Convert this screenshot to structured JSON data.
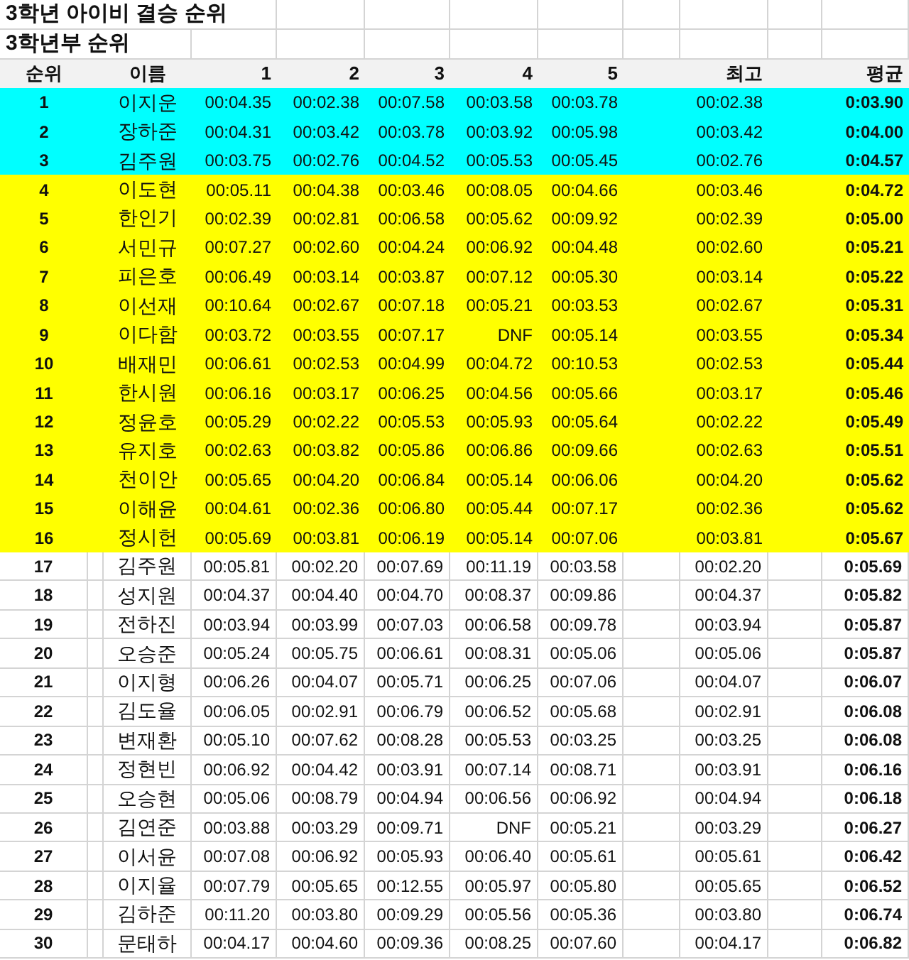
{
  "title": "3학년 아이비 결승 순위",
  "subtitle": "3학년부 순위",
  "columns": [
    "순위",
    "이름",
    "1",
    "2",
    "3",
    "4",
    "5",
    "최고",
    "평균"
  ],
  "rows": [
    {
      "rank": "1",
      "name": "이지운",
      "times": [
        "00:04.35",
        "00:02.38",
        "00:07.58",
        "00:03.58",
        "00:03.78"
      ],
      "best": "00:02.38",
      "average": "0:03.90",
      "color": "#00ffff"
    },
    {
      "rank": "2",
      "name": "장하준",
      "times": [
        "00:04.31",
        "00:03.42",
        "00:03.78",
        "00:03.92",
        "00:05.98"
      ],
      "best": "00:03.42",
      "average": "0:04.00",
      "color": "#00ffff"
    },
    {
      "rank": "3",
      "name": "김주원",
      "times": [
        "00:03.75",
        "00:02.76",
        "00:04.52",
        "00:05.53",
        "00:05.45"
      ],
      "best": "00:02.76",
      "average": "0:04.57",
      "color": "#00ffff"
    },
    {
      "rank": "4",
      "name": "이도현",
      "times": [
        "00:05.11",
        "00:04.38",
        "00:03.46",
        "00:08.05",
        "00:04.66"
      ],
      "best": "00:03.46",
      "average": "0:04.72",
      "color": "#ffff00"
    },
    {
      "rank": "5",
      "name": "한인기",
      "times": [
        "00:02.39",
        "00:02.81",
        "00:06.58",
        "00:05.62",
        "00:09.92"
      ],
      "best": "00:02.39",
      "average": "0:05.00",
      "color": "#ffff00"
    },
    {
      "rank": "6",
      "name": "서민규",
      "times": [
        "00:07.27",
        "00:02.60",
        "00:04.24",
        "00:06.92",
        "00:04.48"
      ],
      "best": "00:02.60",
      "average": "0:05.21",
      "color": "#ffff00"
    },
    {
      "rank": "7",
      "name": "피은호",
      "times": [
        "00:06.49",
        "00:03.14",
        "00:03.87",
        "00:07.12",
        "00:05.30"
      ],
      "best": "00:03.14",
      "average": "0:05.22",
      "color": "#ffff00"
    },
    {
      "rank": "8",
      "name": "이선재",
      "times": [
        "00:10.64",
        "00:02.67",
        "00:07.18",
        "00:05.21",
        "00:03.53"
      ],
      "best": "00:02.67",
      "average": "0:05.31",
      "color": "#ffff00"
    },
    {
      "rank": "9",
      "name": "이다함",
      "times": [
        "00:03.72",
        "00:03.55",
        "00:07.17",
        "DNF",
        "00:05.14"
      ],
      "best": "00:03.55",
      "average": "0:05.34",
      "color": "#ffff00"
    },
    {
      "rank": "10",
      "name": "배재민",
      "times": [
        "00:06.61",
        "00:02.53",
        "00:04.99",
        "00:04.72",
        "00:10.53"
      ],
      "best": "00:02.53",
      "average": "0:05.44",
      "color": "#ffff00"
    },
    {
      "rank": "11",
      "name": "한시원",
      "times": [
        "00:06.16",
        "00:03.17",
        "00:06.25",
        "00:04.56",
        "00:05.66"
      ],
      "best": "00:03.17",
      "average": "0:05.46",
      "color": "#ffff00"
    },
    {
      "rank": "12",
      "name": "정윤호",
      "times": [
        "00:05.29",
        "00:02.22",
        "00:05.53",
        "00:05.93",
        "00:05.64"
      ],
      "best": "00:02.22",
      "average": "0:05.49",
      "color": "#ffff00"
    },
    {
      "rank": "13",
      "name": "유지호",
      "times": [
        "00:02.63",
        "00:03.82",
        "00:05.86",
        "00:06.86",
        "00:09.66"
      ],
      "best": "00:02.63",
      "average": "0:05.51",
      "color": "#ffff00"
    },
    {
      "rank": "14",
      "name": "천이안",
      "times": [
        "00:05.65",
        "00:04.20",
        "00:06.84",
        "00:05.14",
        "00:06.06"
      ],
      "best": "00:04.20",
      "average": "0:05.62",
      "color": "#ffff00"
    },
    {
      "rank": "15",
      "name": "이해윤",
      "times": [
        "00:04.61",
        "00:02.36",
        "00:06.80",
        "00:05.44",
        "00:07.17"
      ],
      "best": "00:02.36",
      "average": "0:05.62",
      "color": "#ffff00"
    },
    {
      "rank": "16",
      "name": "정시헌",
      "times": [
        "00:05.69",
        "00:03.81",
        "00:06.19",
        "00:05.14",
        "00:07.06"
      ],
      "best": "00:03.81",
      "average": "0:05.67",
      "color": "#ffff00"
    },
    {
      "rank": "17",
      "name": "김주원",
      "times": [
        "00:05.81",
        "00:02.20",
        "00:07.69",
        "00:11.19",
        "00:03.58"
      ],
      "best": "00:02.20",
      "average": "0:05.69",
      "color": "#ffffff"
    },
    {
      "rank": "18",
      "name": "성지원",
      "times": [
        "00:04.37",
        "00:04.40",
        "00:04.70",
        "00:08.37",
        "00:09.86"
      ],
      "best": "00:04.37",
      "average": "0:05.82",
      "color": "#ffffff"
    },
    {
      "rank": "19",
      "name": "전하진",
      "times": [
        "00:03.94",
        "00:03.99",
        "00:07.03",
        "00:06.58",
        "00:09.78"
      ],
      "best": "00:03.94",
      "average": "0:05.87",
      "color": "#ffffff"
    },
    {
      "rank": "20",
      "name": "오승준",
      "times": [
        "00:05.24",
        "00:05.75",
        "00:06.61",
        "00:08.31",
        "00:05.06"
      ],
      "best": "00:05.06",
      "average": "0:05.87",
      "color": "#ffffff"
    },
    {
      "rank": "21",
      "name": "이지형",
      "times": [
        "00:06.26",
        "00:04.07",
        "00:05.71",
        "00:06.25",
        "00:07.06"
      ],
      "best": "00:04.07",
      "average": "0:06.07",
      "color": "#ffffff"
    },
    {
      "rank": "22",
      "name": "김도율",
      "times": [
        "00:06.05",
        "00:02.91",
        "00:06.79",
        "00:06.52",
        "00:05.68"
      ],
      "best": "00:02.91",
      "average": "0:06.08",
      "color": "#ffffff"
    },
    {
      "rank": "23",
      "name": "변재환",
      "times": [
        "00:05.10",
        "00:07.62",
        "00:08.28",
        "00:05.53",
        "00:03.25"
      ],
      "best": "00:03.25",
      "average": "0:06.08",
      "color": "#ffffff"
    },
    {
      "rank": "24",
      "name": "정현빈",
      "times": [
        "00:06.92",
        "00:04.42",
        "00:03.91",
        "00:07.14",
        "00:08.71"
      ],
      "best": "00:03.91",
      "average": "0:06.16",
      "color": "#ffffff"
    },
    {
      "rank": "25",
      "name": "오승현",
      "times": [
        "00:05.06",
        "00:08.79",
        "00:04.94",
        "00:06.56",
        "00:06.92"
      ],
      "best": "00:04.94",
      "average": "0:06.18",
      "color": "#ffffff"
    },
    {
      "rank": "26",
      "name": "김연준",
      "times": [
        "00:03.88",
        "00:03.29",
        "00:09.71",
        "DNF",
        "00:05.21"
      ],
      "best": "00:03.29",
      "average": "0:06.27",
      "color": "#ffffff"
    },
    {
      "rank": "27",
      "name": "이서윤",
      "times": [
        "00:07.08",
        "00:06.92",
        "00:05.93",
        "00:06.40",
        "00:05.61"
      ],
      "best": "00:05.61",
      "average": "0:06.42",
      "color": "#ffffff"
    },
    {
      "rank": "28",
      "name": "이지율",
      "times": [
        "00:07.79",
        "00:05.65",
        "00:12.55",
        "00:05.97",
        "00:05.80"
      ],
      "best": "00:05.65",
      "average": "0:06.52",
      "color": "#ffffff"
    },
    {
      "rank": "29",
      "name": "김하준",
      "times": [
        "00:11.20",
        "00:03.80",
        "00:09.29",
        "00:05.56",
        "00:05.36"
      ],
      "best": "00:03.80",
      "average": "0:06.74",
      "color": "#ffffff"
    },
    {
      "rank": "30",
      "name": "문태하",
      "times": [
        "00:04.17",
        "00:04.60",
        "00:09.36",
        "00:08.25",
        "00:07.60"
      ],
      "best": "00:04.17",
      "average": "0:06.82",
      "color": "#ffffff"
    }
  ]
}
